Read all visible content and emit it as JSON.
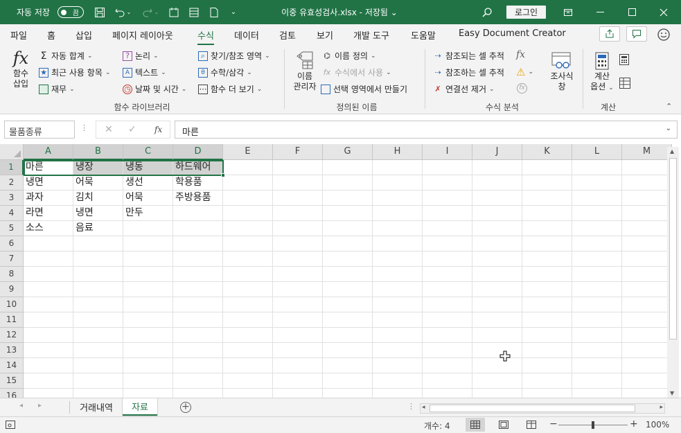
{
  "titlebar": {
    "autosave_label": "자동 저장",
    "autosave_state": "끔",
    "title": "이중 유효성검사.xlsx - 저장됨 ⌄",
    "login": "로그인"
  },
  "ribbon_tabs": [
    "파일",
    "홈",
    "삽입",
    "페이지 레이아웃",
    "수식",
    "데이터",
    "검토",
    "보기",
    "개발 도구",
    "도움말",
    "Easy Document Creator"
  ],
  "active_tab": "수식",
  "ribbon": {
    "function_library": {
      "insert_function": "함수\n삽입",
      "autosum": "자동 합계",
      "recent": "최근 사용 항목",
      "financial": "재무",
      "logical": "논리",
      "text": "텍스트",
      "datetime": "날짜 및 시간",
      "lookup": "찾기/참조 영역",
      "math": "수학/삼각",
      "more": "함수 더 보기",
      "group_label": "함수 라이브러리"
    },
    "defined_names": {
      "name_manager": "이름\n관리자",
      "define_name": "이름 정의",
      "use_in_formula": "수식에서 사용",
      "create_from_selection": "선택 영역에서 만들기",
      "group_label": "정의된 이름"
    },
    "formula_auditing": {
      "trace_precedents": "참조되는 셀 추적",
      "trace_dependents": "참조하는 셀 추적",
      "remove_arrows": "연결선 제거",
      "watch_window": "조사식\n창",
      "group_label": "수식 분석"
    },
    "calculation": {
      "calc_options": "계산\n옵션",
      "group_label": "계산"
    }
  },
  "formula_bar": {
    "name_box": "물품종류",
    "fx": "fx",
    "formula": "마른"
  },
  "columns": [
    "A",
    "B",
    "C",
    "D",
    "E",
    "F",
    "G",
    "H",
    "I",
    "J",
    "K",
    "L",
    "M"
  ],
  "rows": [
    "1",
    "2",
    "3",
    "4",
    "5",
    "6",
    "7",
    "8",
    "9",
    "10",
    "11",
    "12",
    "13",
    "14",
    "15",
    "16"
  ],
  "cells": [
    [
      "마른",
      "냉장",
      "냉동",
      "하드웨어"
    ],
    [
      "냉면",
      "어묵",
      "생선",
      "학용품"
    ],
    [
      "과자",
      "김치",
      "어묵",
      "주방용품"
    ],
    [
      "라면",
      "냉면",
      "만두",
      ""
    ],
    [
      "소스",
      "음료",
      "",
      ""
    ]
  ],
  "sheets": [
    "거래내역",
    "자료"
  ],
  "active_sheet": "자료",
  "statusbar": {
    "count": "개수: 4",
    "zoom": "100%"
  }
}
